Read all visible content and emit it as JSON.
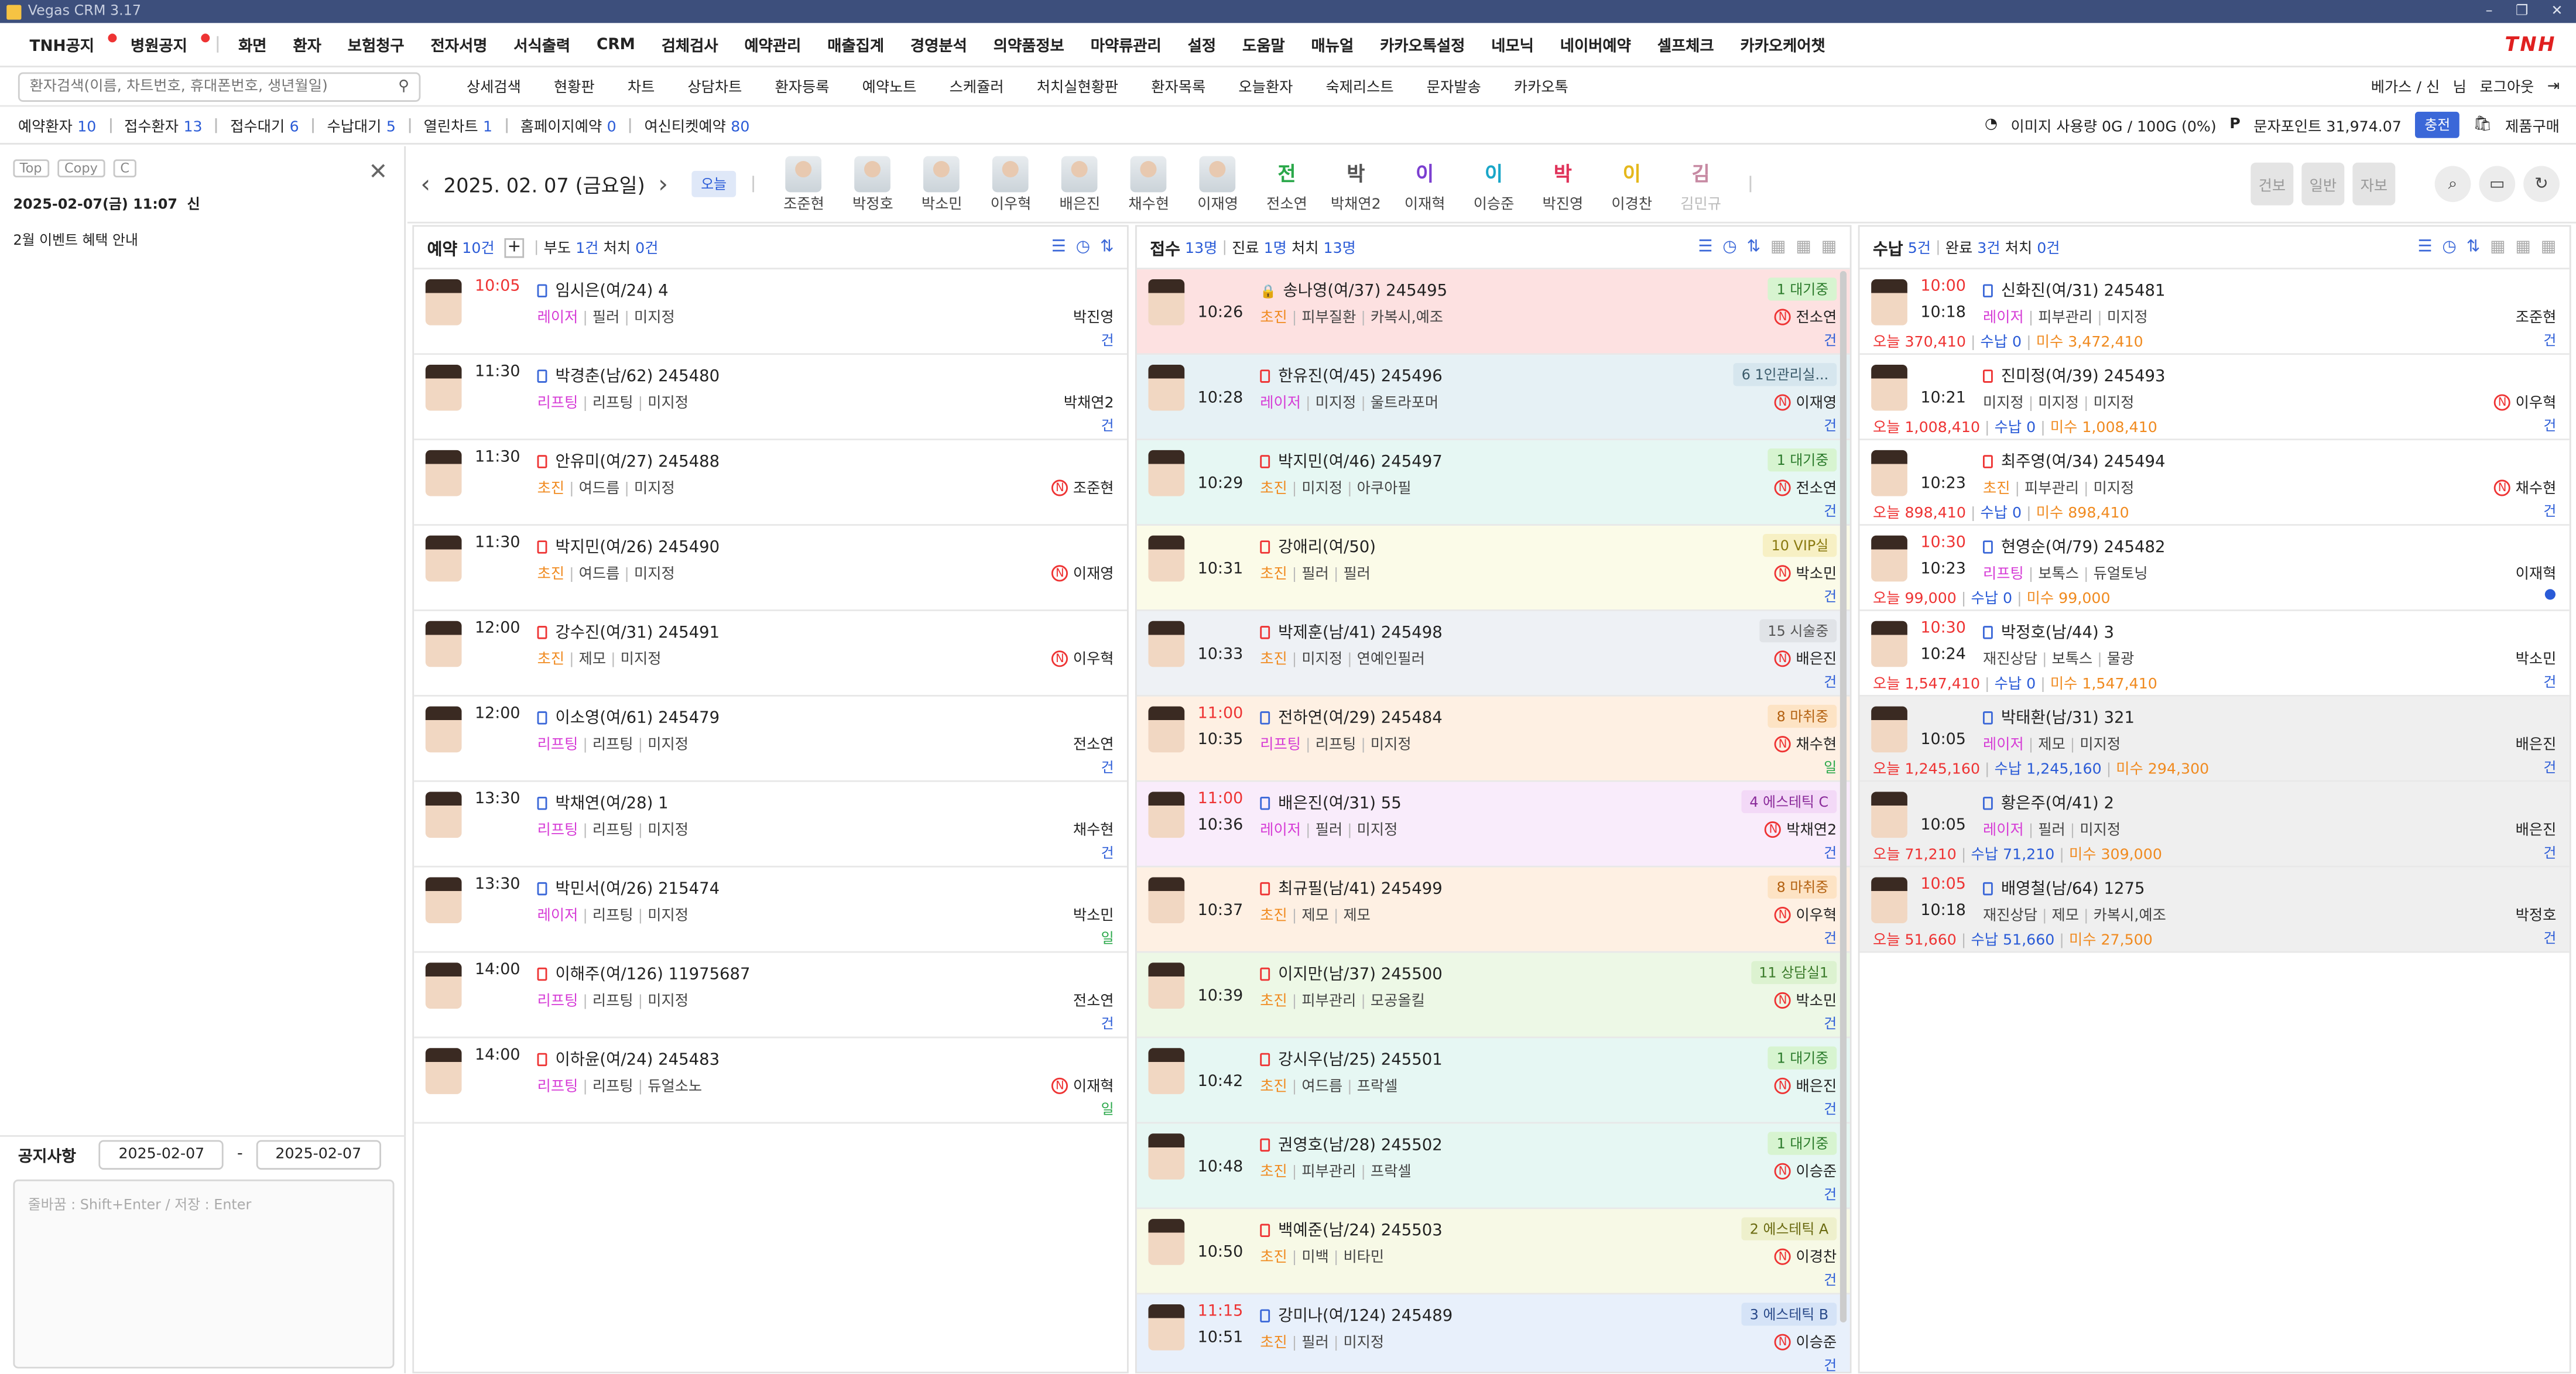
{
  "window_title": "Vegas CRM 3.17",
  "menu": {
    "items": [
      "TNH공지",
      "병원공지",
      "화면",
      "환자",
      "보험청구",
      "전자서명",
      "서식출력",
      "CRM",
      "검체검사",
      "예약관리",
      "매출집계",
      "경영분석",
      "의약품정보",
      "마약류관리",
      "설정",
      "도움말",
      "매뉴얼",
      "카카오톡설정",
      "네모닉",
      "네이버예약",
      "셀프체크",
      "카카오케어챗"
    ],
    "brand": "TNH"
  },
  "search": {
    "placeholder": "환자검색(이름, 차트번호, 휴대폰번호, 생년월일)"
  },
  "subnav": [
    "상세검색",
    "현황판",
    "차트",
    "상담차트",
    "환자등록",
    "예약노트",
    "스케쥴러",
    "처치실현황판",
    "환자목록",
    "오늘환자",
    "숙제리스트",
    "문자발송",
    "카카오톡"
  ],
  "user": {
    "name": "베가스 / 신",
    "role": "님",
    "logout": "로그아웃"
  },
  "stats": [
    {
      "label": "예약환자",
      "value": "10"
    },
    {
      "label": "접수환자",
      "value": "13"
    },
    {
      "label": "접수대기",
      "value": "6"
    },
    {
      "label": "수납대기",
      "value": "5"
    },
    {
      "label": "열린차트",
      "value": "1"
    },
    {
      "label": "홈페이지예약",
      "value": "0"
    },
    {
      "label": "여신티켓예약",
      "value": "80"
    }
  ],
  "image_usage": "이미지 사용량 0G / 100G (0%)",
  "sms_points": "문자포인트 31,974.07",
  "charge_label": "충전",
  "product_buy": "제품구매",
  "left": {
    "btns": [
      "Top",
      "Copy",
      "C"
    ],
    "date": "2025-02-07(금) 11:07",
    "user": "신",
    "memo": "2월 이벤트 혜택 안내",
    "notice_label": "공지사항",
    "from": "2025-02-07",
    "to": "2025-02-07",
    "note_placeholder": "줄바꿈 : Shift+Enter / 저장 : Enter"
  },
  "date_header": {
    "date": "2025. 02. 07 (금요일)",
    "today": "오늘"
  },
  "doctors": [
    {
      "name": "조준현",
      "photo": true
    },
    {
      "name": "박정호",
      "photo": true
    },
    {
      "name": "박소민",
      "photo": true
    },
    {
      "name": "이우혁",
      "photo": true
    },
    {
      "name": "배은진",
      "photo": true
    },
    {
      "name": "채수현",
      "photo": true
    },
    {
      "name": "이재영",
      "photo": true
    },
    {
      "name": "전소연",
      "init": "전",
      "color": "#2aa84a"
    },
    {
      "name": "박채연2",
      "init": "박",
      "color": "#555"
    },
    {
      "name": "이재혁",
      "init": "이",
      "color": "#7b3fd0"
    },
    {
      "name": "이승준",
      "init": "이",
      "color": "#1aa6c8"
    },
    {
      "name": "박진영",
      "init": "박",
      "color": "#e0335a"
    },
    {
      "name": "이경찬",
      "init": "이",
      "color": "#e5b81c"
    },
    {
      "name": "김민규",
      "init": "김",
      "color": "#c78aa3"
    }
  ],
  "hdr_btns": [
    "건보",
    "일반",
    "자보"
  ],
  "columns": {
    "reservation": {
      "title": "예약",
      "count": "10건",
      "sub": "부도",
      "sub_count": "1건",
      "sub2": "처치",
      "sub2_count": "0건"
    },
    "reception": {
      "title": "접수",
      "count": "13명",
      "sub": "진료",
      "sub_count": "1명",
      "sub2": "처치",
      "sub2_count": "13명"
    },
    "payment": {
      "title": "수납",
      "count": "5건",
      "sub": "완료",
      "sub_count": "3건",
      "sub2": "처치",
      "sub2_count": "0건"
    }
  },
  "reservations": [
    {
      "time": "10:05",
      "red": true,
      "name": "임시은(여/24)",
      "id": "4",
      "tag": "레이저",
      "t2": "필러",
      "t3": "미지정",
      "doctor": "박진영",
      "n": false,
      "mark": "건"
    },
    {
      "time": "11:30",
      "name": "박경춘(남/62)",
      "id": "245480",
      "tag": "리프팅",
      "t2": "리프팅",
      "t3": "미지정",
      "doctor": "박채연2",
      "n": false,
      "mark": "건"
    },
    {
      "time": "11:30",
      "name": "안유미(여/27)",
      "id": "245488",
      "tag": "초진",
      "t2": "여드름",
      "t3": "미지정",
      "doctor": "조준현",
      "n": true,
      "mark": ""
    },
    {
      "time": "11:30",
      "name": "박지민(여/26)",
      "id": "245490",
      "tag": "초진",
      "t2": "여드름",
      "t3": "미지정",
      "doctor": "이재영",
      "n": true,
      "mark": ""
    },
    {
      "time": "12:00",
      "name": "강수진(여/31)",
      "id": "245491",
      "tag": "초진",
      "t2": "제모",
      "t3": "미지정",
      "doctor": "이우혁",
      "n": true,
      "mark": ""
    },
    {
      "time": "12:00",
      "name": "이소영(여/61)",
      "id": "245479",
      "tag": "리프팅",
      "t2": "리프팅",
      "t3": "미지정",
      "doctor": "전소연",
      "n": false,
      "mark": "건"
    },
    {
      "time": "13:30",
      "name": "박채연(여/28)",
      "id": "1",
      "tag": "리프팅",
      "t2": "리프팅",
      "t3": "미지정",
      "doctor": "채수현",
      "n": false,
      "mark": "건"
    },
    {
      "time": "13:30",
      "name": "박민서(여/26)",
      "id": "215474",
      "tag": "레이저",
      "t2": "리프팅",
      "t3": "미지정",
      "doctor": "박소민",
      "n": false,
      "mark": "일"
    },
    {
      "time": "14:00",
      "name": "이해주(여/126)",
      "id": "11975687",
      "tag": "리프팅",
      "t2": "리프팅",
      "t3": "미지정",
      "doctor": "전소연",
      "n": false,
      "mark": "건"
    },
    {
      "time": "14:00",
      "name": "이하윤(여/24)",
      "id": "245483",
      "tag": "리프팅",
      "t2": "리프팅",
      "t3": "듀얼소노",
      "doctor": "이재혁",
      "n": true,
      "mark": "일"
    }
  ],
  "receptions": [
    {
      "time": "10:26",
      "rtime": "",
      "name": "송나영(여/37)",
      "id": "245495",
      "tag": "초진",
      "t2": "피부질환",
      "t3": "카복시,예조",
      "status": "1 대기중",
      "doctor": "전소연",
      "mark": "건",
      "bg": "#fde1e1",
      "lock": true
    },
    {
      "time": "10:28",
      "rtime": "",
      "name": "한유진(여/45)",
      "id": "245496",
      "tag": "레이저",
      "t2": "미지정",
      "t3": "울트라포머",
      "status": "6 1인관리실...",
      "doctor": "이재영",
      "mark": "건",
      "bg": "#e6f1f5"
    },
    {
      "time": "10:29",
      "rtime": "",
      "name": "박지민(여/46)",
      "id": "245497",
      "tag": "초진",
      "t2": "미지정",
      "t3": "아쿠아필",
      "status": "1 대기중",
      "doctor": "전소연",
      "mark": "건",
      "bg": "#e6f7f3"
    },
    {
      "time": "10:31",
      "rtime": "",
      "name": "강애리(여/50)",
      "id": "",
      "tag": "초진",
      "t2": "필러",
      "t3": "필러",
      "status": "10 VIP실",
      "doctor": "박소민",
      "mark": "건",
      "bg": "#fbfbe8"
    },
    {
      "time": "10:33",
      "rtime": "",
      "name": "박제훈(남/41)",
      "id": "245498",
      "tag": "초진",
      "t2": "미지정",
      "t3": "연예인필러",
      "status": "15 시술중",
      "doctor": "배은진",
      "mark": "건",
      "bg": "#eef1f5"
    },
    {
      "time": "10:35",
      "rtime": "11:00",
      "name": "전하연(여/29)",
      "id": "245484",
      "tag": "리프팅",
      "t2": "리프팅",
      "t3": "미지정",
      "status": "8 마취중",
      "doctor": "채수현",
      "mark": "일",
      "bg": "#fef0e3"
    },
    {
      "time": "10:36",
      "rtime": "11:00",
      "name": "배은진(여/31)",
      "id": "55",
      "tag": "레이저",
      "t2": "필러",
      "t3": "미지정",
      "status": "4 에스테틱 C",
      "doctor": "박채연2",
      "mark": "건",
      "bg": "#f9ecfb"
    },
    {
      "time": "10:37",
      "rtime": "",
      "name": "최규필(남/41)",
      "id": "245499",
      "tag": "초진",
      "t2": "제모",
      "t3": "제모",
      "status": "8 마취중",
      "doctor": "이우혁",
      "mark": "건",
      "bg": "#fef0e3"
    },
    {
      "time": "10:39",
      "rtime": "",
      "name": "이지만(남/37)",
      "id": "245500",
      "tag": "초진",
      "t2": "피부관리",
      "t3": "모공올킬",
      "status": "11 상담실1",
      "doctor": "박소민",
      "mark": "건",
      "bg": "#edf8e6"
    },
    {
      "time": "10:42",
      "rtime": "",
      "name": "강시우(남/25)",
      "id": "245501",
      "tag": "초진",
      "t2": "여드름",
      "t3": "프락셀",
      "status": "1 대기중",
      "doctor": "배은진",
      "mark": "건",
      "bg": "#e6f7f3"
    },
    {
      "time": "10:48",
      "rtime": "",
      "name": "권영호(남/28)",
      "id": "245502",
      "tag": "초진",
      "t2": "피부관리",
      "t3": "프락셀",
      "status": "1 대기중",
      "doctor": "이승준",
      "mark": "건",
      "bg": "#e6f7f3"
    },
    {
      "time": "10:50",
      "rtime": "",
      "name": "백예준(남/24)",
      "id": "245503",
      "tag": "초진",
      "t2": "미백",
      "t3": "비타민",
      "status": "2 에스테틱 A",
      "doctor": "이경찬",
      "mark": "건",
      "bg": "#f7f9e6"
    },
    {
      "time": "10:51",
      "rtime": "11:15",
      "name": "강미나(여/124)",
      "id": "245489",
      "tag": "초진",
      "t2": "필러",
      "t3": "미지정",
      "status": "3 에스테틱 B",
      "doctor": "이승준",
      "mark": "건",
      "bg": "#e8f0fb"
    }
  ],
  "payments": [
    {
      "time": "10:18",
      "rtime": "10:00",
      "name": "신화진(여/31)",
      "id": "245481",
      "tag": "레이저",
      "t2": "피부관리",
      "t3": "미지정",
      "doctor": "조준현",
      "n": false,
      "today": "오늘 370,410",
      "paid": "수납 0",
      "due": "미수 3,472,410",
      "mark": "건",
      "bg": "#fff"
    },
    {
      "time": "10:21",
      "rtime": "",
      "name": "진미정(여/39)",
      "id": "245493",
      "tag": "미지정",
      "t2": "미지정",
      "t3": "미지정",
      "doctor": "이우혁",
      "n": true,
      "today": "오늘 1,008,410",
      "paid": "수납 0",
      "due": "미수 1,008,410",
      "mark": "건",
      "bg": "#fff",
      "plain": true
    },
    {
      "time": "10:23",
      "rtime": "",
      "name": "최주영(여/34)",
      "id": "245494",
      "tag": "초진",
      "t2": "피부관리",
      "t3": "미지정",
      "doctor": "채수현",
      "n": true,
      "today": "오늘 898,410",
      "paid": "수납 0",
      "due": "미수 898,410",
      "mark": "건",
      "bg": "#fff"
    },
    {
      "time": "10:23",
      "rtime": "10:30",
      "name": "현영순(여/79)",
      "id": "245482",
      "tag": "리프팅",
      "t2": "보톡스",
      "t3": "듀얼토닝",
      "doctor": "이재혁",
      "n": false,
      "today": "오늘 99,000",
      "paid": "수납 0",
      "due": "미수 99,000",
      "mark": "●",
      "bg": "#fff"
    },
    {
      "time": "10:24",
      "rtime": "10:30",
      "name": "박정호(남/44)",
      "id": "3",
      "tag": "재진상담",
      "t2": "보톡스",
      "t3": "물광",
      "doctor": "박소민",
      "n": false,
      "today": "오늘 1,547,410",
      "paid": "수납 0",
      "due": "미수 1,547,410",
      "mark": "건",
      "bg": "#fff",
      "plain": true
    },
    {
      "time": "10:05",
      "rtime": "",
      "name": "박태환(남/31)",
      "id": "321",
      "tag": "레이저",
      "t2": "제모",
      "t3": "미지정",
      "doctor": "배은진",
      "n": false,
      "today": "오늘 1,245,160",
      "paid": "수납 1,245,160",
      "due": "미수 294,300",
      "mark": "건",
      "bg": "#efefef"
    },
    {
      "time": "10:05",
      "rtime": "",
      "name": "황은주(여/41)",
      "id": "2",
      "tag": "레이저",
      "t2": "필러",
      "t3": "미지정",
      "doctor": "배은진",
      "n": false,
      "today": "오늘 71,210",
      "paid": "수납 71,210",
      "due": "미수 309,000",
      "mark": "건",
      "bg": "#efefef"
    },
    {
      "time": "10:18",
      "rtime": "10:05",
      "name": "배영철(남/64)",
      "id": "1275",
      "tag": "재진상담",
      "t2": "제모",
      "t3": "카복시,예조",
      "doctor": "박정호",
      "n": false,
      "today": "오늘 51,660",
      "paid": "수납 51,660",
      "due": "미수 27,500",
      "mark": "건",
      "bg": "#efefef",
      "plain": true
    }
  ]
}
